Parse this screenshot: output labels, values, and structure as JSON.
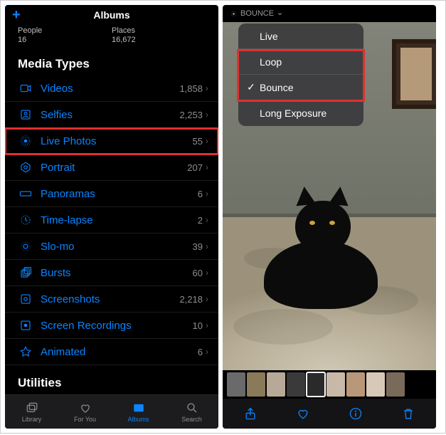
{
  "left": {
    "header_title": "Albums",
    "stats": {
      "people_label": "People",
      "people_value": "16",
      "places_label": "Places",
      "places_value": "16,672"
    },
    "media_types_heading": "Media Types",
    "rows": [
      {
        "icon": "video",
        "label": "Videos",
        "count": "1,858"
      },
      {
        "icon": "selfie",
        "label": "Selfies",
        "count": "2,253"
      },
      {
        "icon": "live",
        "label": "Live Photos",
        "count": "55",
        "highlight": true
      },
      {
        "icon": "portrait",
        "label": "Portrait",
        "count": "207"
      },
      {
        "icon": "pano",
        "label": "Panoramas",
        "count": "6"
      },
      {
        "icon": "timelapse",
        "label": "Time-lapse",
        "count": "2"
      },
      {
        "icon": "slomo",
        "label": "Slo-mo",
        "count": "39"
      },
      {
        "icon": "bursts",
        "label": "Bursts",
        "count": "60"
      },
      {
        "icon": "screenshots",
        "label": "Screenshots",
        "count": "2,218"
      },
      {
        "icon": "screenrec",
        "label": "Screen Recordings",
        "count": "10"
      },
      {
        "icon": "animated",
        "label": "Animated",
        "count": "6"
      }
    ],
    "utilities_heading": "Utilities",
    "tabs": {
      "library": "Library",
      "foryou": "For You",
      "albums": "Albums",
      "search": "Search"
    }
  },
  "right": {
    "effect_label": "BOUNCE",
    "menu": [
      {
        "label": "Live",
        "checked": false
      },
      {
        "label": "Loop",
        "checked": false
      },
      {
        "label": "Bounce",
        "checked": true
      },
      {
        "label": "Long Exposure",
        "checked": false
      }
    ],
    "thumb_count": 9,
    "selected_thumb": 4
  }
}
